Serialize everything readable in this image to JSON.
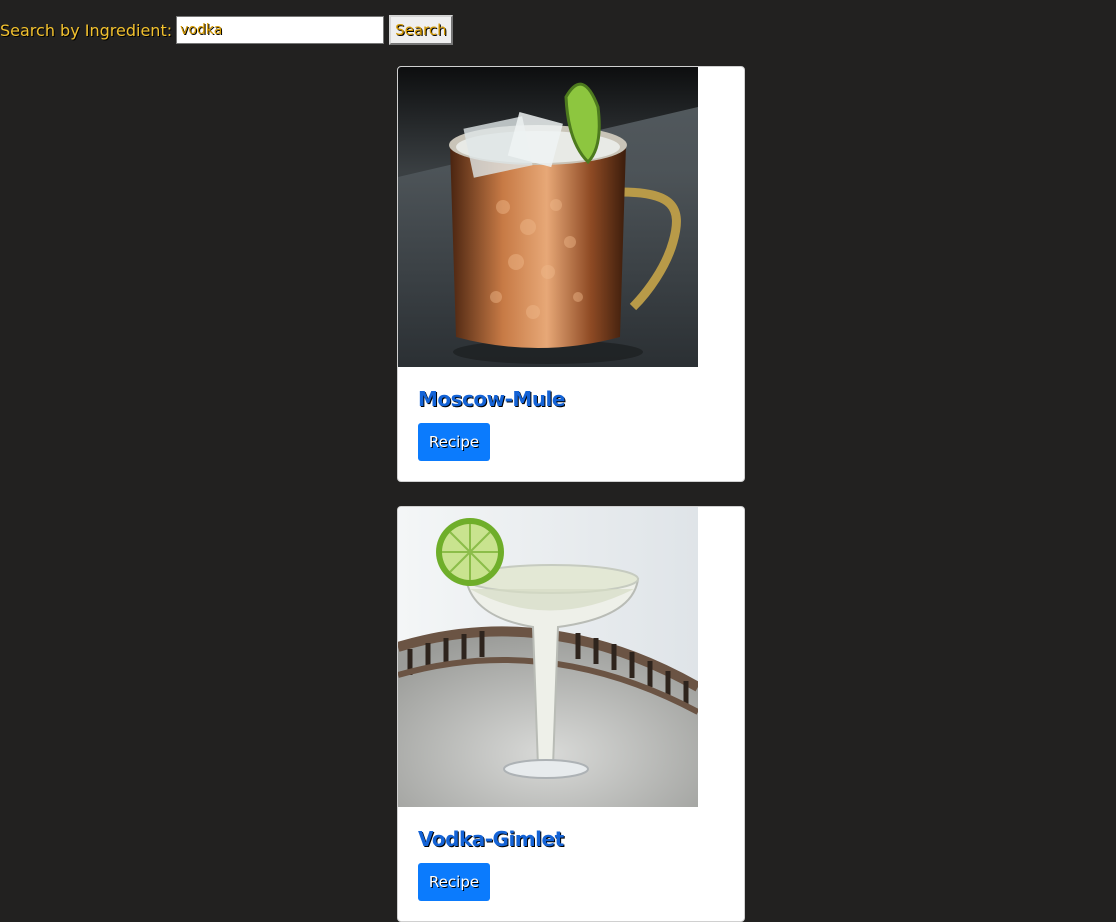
{
  "search": {
    "label": "Search by Ingredient:",
    "value": "vodka",
    "button_label": "Search"
  },
  "drinks": [
    {
      "title": "Moscow-Mule",
      "button_label": "Recipe"
    },
    {
      "title": "Vodka-Gimlet",
      "button_label": "Recipe"
    }
  ],
  "colors": {
    "background": "#222120",
    "label_text": "#f2c12e",
    "title_text": "#1463d6",
    "button_bg": "#0b7bfd"
  }
}
